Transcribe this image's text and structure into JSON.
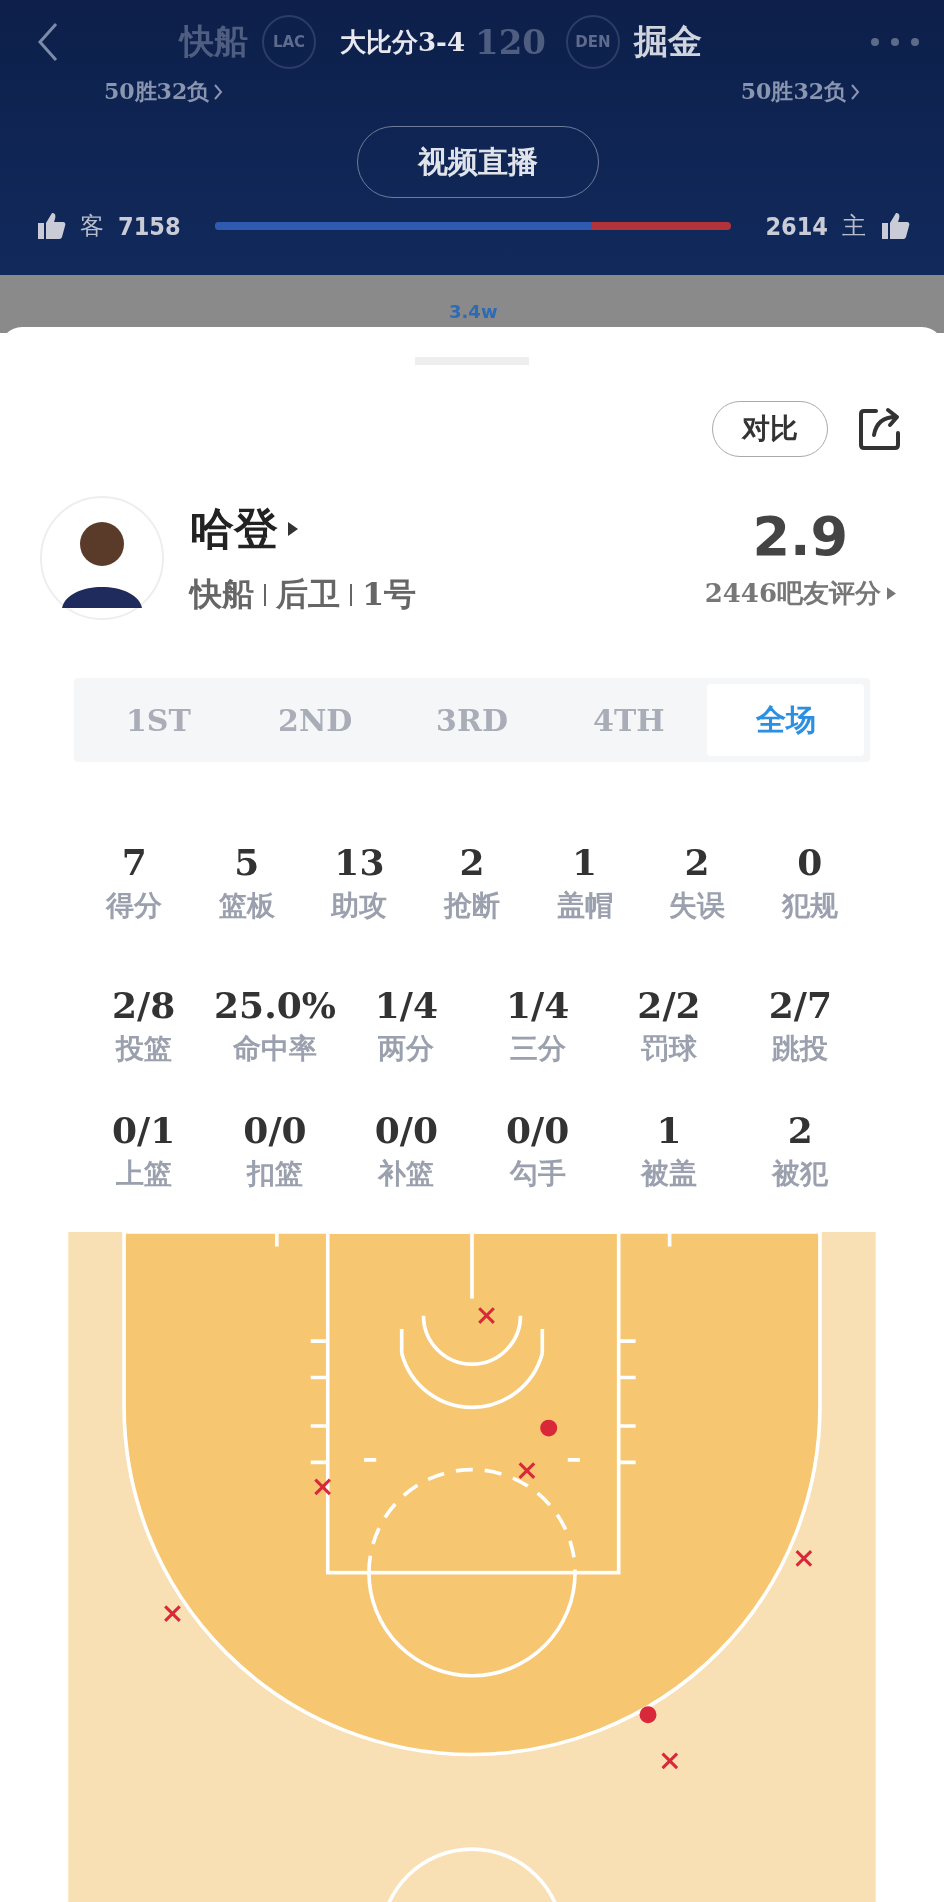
{
  "header": {
    "away_team": "快船",
    "away_logo": "LAC",
    "series": "大比分3-4",
    "home_score": "120",
    "home_logo": "DEN",
    "home_team": "掘金",
    "away_record": "50胜32负",
    "home_record": "50胜32负",
    "live_button": "视频直播",
    "away_label": "客",
    "away_likes": "7158",
    "home_likes": "2614",
    "home_label": "主",
    "level": 0.73
  },
  "chat_count": "3.4w",
  "compare_button": "对比",
  "player": {
    "name": "哈登",
    "team": "快船",
    "position": "后卫",
    "number": "1号",
    "rating": "2.9",
    "rating_count": "2446吧友评分"
  },
  "periods": [
    {
      "label": "1ST",
      "selected": false
    },
    {
      "label": "2ND",
      "selected": false
    },
    {
      "label": "3RD",
      "selected": false
    },
    {
      "label": "4TH",
      "selected": false
    },
    {
      "label": "全场",
      "selected": true
    }
  ],
  "stat_rows": [
    [
      {
        "value": "7",
        "label": "得分"
      },
      {
        "value": "5",
        "label": "篮板"
      },
      {
        "value": "13",
        "label": "助攻"
      },
      {
        "value": "2",
        "label": "抢断"
      },
      {
        "value": "1",
        "label": "盖帽"
      },
      {
        "value": "2",
        "label": "失误"
      },
      {
        "value": "0",
        "label": "犯规"
      }
    ],
    [
      {
        "value": "2/8",
        "label": "投篮"
      },
      {
        "value": "25.0%",
        "label": "命中率"
      },
      {
        "value": "1/4",
        "label": "两分"
      },
      {
        "value": "1/4",
        "label": "三分"
      },
      {
        "value": "2/2",
        "label": "罚球"
      },
      {
        "value": "2/7",
        "label": "跳投"
      }
    ],
    [
      {
        "value": "0/1",
        "label": "上篮"
      },
      {
        "value": "0/0",
        "label": "扣篮"
      },
      {
        "value": "0/0",
        "label": "补篮"
      },
      {
        "value": "0/0",
        "label": "勾手"
      },
      {
        "value": "1",
        "label": "被盖"
      },
      {
        "value": "2",
        "label": "被犯"
      }
    ]
  ],
  "shots": [
    {
      "made": false
    },
    {
      "made": true
    },
    {
      "made": false
    },
    {
      "made": false
    },
    {
      "made": false
    },
    {
      "made": false
    },
    {
      "made": true
    },
    {
      "made": false
    }
  ]
}
